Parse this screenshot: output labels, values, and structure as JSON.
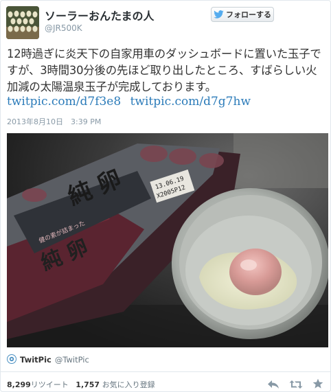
{
  "user": {
    "display_name": "ソーラーおんたまの人",
    "screen_name": "@JR500K"
  },
  "follow_button": {
    "label": "フォローする"
  },
  "tweet": {
    "text": "12時過ぎに炎天下の自家用車のダッシュボードに置いた玉子ですが、3時間30分後の先ほど取り出したところ、すばらしい火加減の太陽温泉玉子が完成しております。",
    "links": [
      "twitpic.com/d7f3e8",
      "twitpic.com/d7g7hw"
    ],
    "timestamp": "2013年8月10日　3:39 PM"
  },
  "photo": {
    "carton_text_main": "純 卵",
    "carton_text_side": "純 卵",
    "carton_banner": "健の素が詰まった",
    "label_line1": "13.06.19",
    "label_line2": "X2005P12"
  },
  "credit": {
    "brand": "TwitPic",
    "handle": "@TwitPic"
  },
  "stats": {
    "retweets": "8,299",
    "retweets_label": "リツイート",
    "favorites": "1,757",
    "favorites_label": "お気に入り登録"
  },
  "colors": {
    "link": "#2b7bb9",
    "twitter_blue": "#55acee",
    "muted": "#8899a6"
  }
}
